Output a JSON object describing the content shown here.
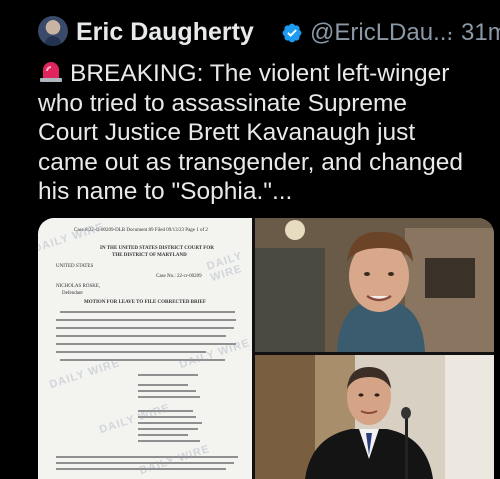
{
  "tweet": {
    "author_name": "Eric Daugherty",
    "handle": "@EricLDau...",
    "separator": "·",
    "time": "31m",
    "text_lines": [
      "BREAKING: The violent left-winger",
      "who tried to assassinate Supreme",
      "Court Justice Brett Kavanaugh just",
      "came out as transgender, and changed",
      "his name to \"Sophia.\"..."
    ]
  },
  "media": {
    "document": {
      "header_line": "Case 8:22-cr-00209-DLB   Document 89   Filed 09/13/23   Page 1 of 2",
      "court_title": "IN THE UNITED STATES DISTRICT COURT FOR",
      "court_district": "THE DISTRICT OF MARYLAND",
      "party": "UNITED STATES",
      "case_no": "Case No.: 22-cr-00209",
      "defendant": "NICHOLAS ROSKE,",
      "defendant_role": "Defendant",
      "motion_title": "MOTION FOR LEAVE TO FILE CORRECTED BRIEF",
      "watermark": "DAILY WIRE"
    }
  },
  "colors": {
    "background": "#000000",
    "text": "#e7e9ea",
    "muted": "#8b98a5",
    "verified_badge": "#1d9bf0",
    "siren": "#e0245e"
  },
  "icons": [
    "avatar",
    "verified-badge-icon",
    "siren-emoji-icon"
  ]
}
